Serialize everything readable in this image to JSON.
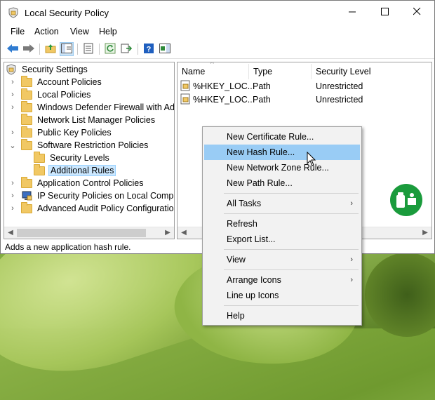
{
  "window": {
    "title": "Local Security Policy"
  },
  "menu": [
    "File",
    "Action",
    "View",
    "Help"
  ],
  "tree": {
    "root": "Security Settings",
    "items": [
      {
        "label": "Account Policies",
        "chev": "›"
      },
      {
        "label": "Local Policies",
        "chev": "›"
      },
      {
        "label": "Windows Defender Firewall with Adva",
        "chev": "›"
      },
      {
        "label": "Network List Manager Policies",
        "chev": ""
      },
      {
        "label": "Public Key Policies",
        "chev": "›"
      },
      {
        "label": "Software Restriction Policies",
        "chev": "⌄"
      },
      {
        "label": "Security Levels",
        "chev": ""
      },
      {
        "label": "Additional Rules",
        "chev": ""
      },
      {
        "label": "Application Control Policies",
        "chev": "›"
      },
      {
        "label": "IP Security Policies on Local Compute",
        "chev": "›"
      },
      {
        "label": "Advanced Audit Policy Configuration",
        "chev": "›"
      }
    ]
  },
  "list": {
    "columns": [
      "Name",
      "Type",
      "Security Level"
    ],
    "rows": [
      {
        "name": "%HKEY_LOC...",
        "type": "Path",
        "level": "Unrestricted"
      },
      {
        "name": "%HKEY_LOC...",
        "type": "Path",
        "level": "Unrestricted"
      }
    ]
  },
  "status": "Adds a new application hash rule.",
  "context_menu": {
    "items": [
      {
        "label": "New Certificate Rule..."
      },
      {
        "label": "New Hash Rule...",
        "highlighted": true
      },
      {
        "label": "New Network Zone Rule..."
      },
      {
        "label": "New Path Rule..."
      },
      {
        "label": "All Tasks",
        "submenu": "›"
      },
      {
        "label": "Refresh"
      },
      {
        "label": "Export List..."
      },
      {
        "label": "View",
        "submenu": "›"
      },
      {
        "label": "Arrange Icons",
        "submenu": "›"
      },
      {
        "label": "Line up Icons"
      },
      {
        "label": "Help"
      }
    ]
  },
  "icons": [
    "shield-policy-icon",
    "minimize-icon",
    "maximize-icon",
    "close-icon",
    "back-icon",
    "forward-icon",
    "up-folder-icon",
    "show-tree-icon",
    "properties-icon",
    "refresh-icon",
    "export-icon",
    "help-icon",
    "action-pane-icon",
    "folder-icon",
    "lock-folder-icon",
    "rule-icon",
    "pointer-icon"
  ],
  "colors": {
    "highlight": "#99ccf5",
    "selection": "#cce8ff",
    "folder": "#f1c864"
  }
}
